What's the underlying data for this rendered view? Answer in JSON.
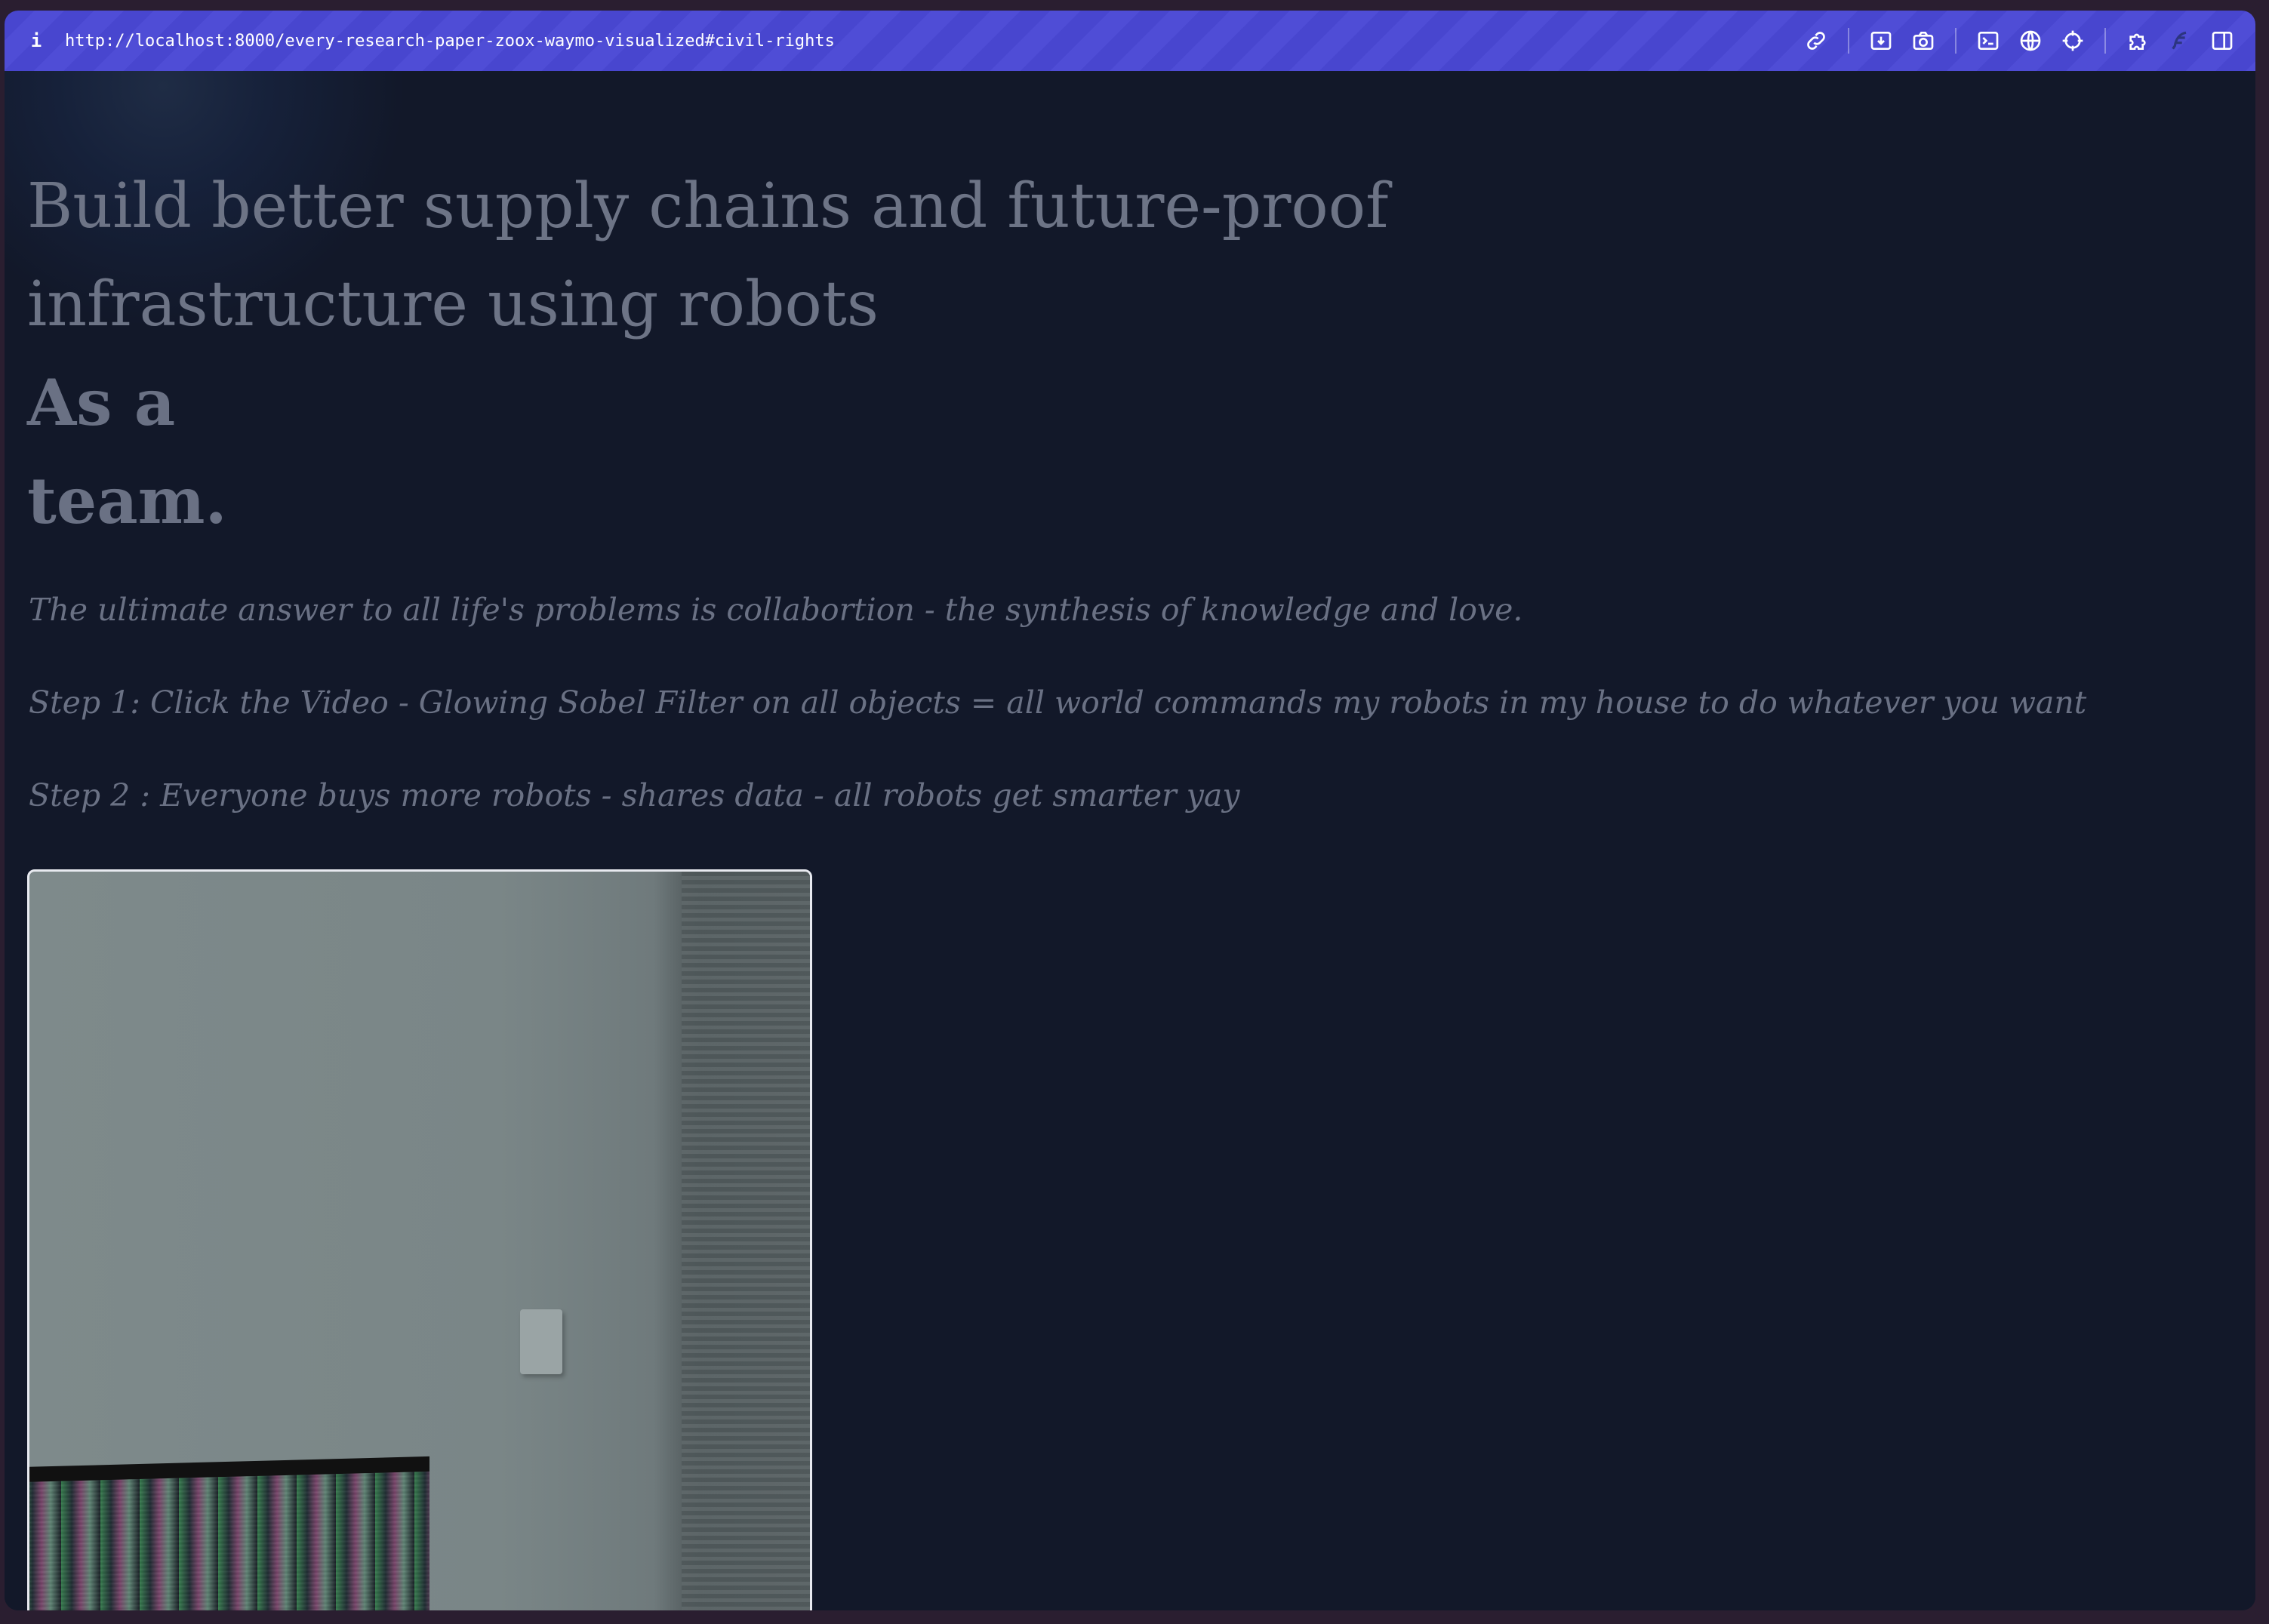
{
  "browser": {
    "info_icon": "i",
    "url": "http://localhost:8000/every-research-paper-zoox-waymo-visualized#civil-rights",
    "tools": [
      "link-icon",
      "save-page-icon",
      "camera-icon",
      "terminal-icon",
      "globe-icon",
      "crosshair-icon",
      "extension-icon",
      "feather-icon",
      "sidebar-icon"
    ]
  },
  "hero": {
    "title": "Build better supply chains and future-proof infrastructure using robots",
    "line1": "As a",
    "line2": "team."
  },
  "body": {
    "quote": "The ultimate answer to all life's problems is collabortion - the synthesis of knowledge and love.",
    "step1": "Step 1: Click the Video - Glowing Sobel Filter on all objects = all world commands my robots in my house to do whatever you want",
    "step2": "Step 2 : Everyone buys more robots - shares data - all robots get smarter yay"
  }
}
